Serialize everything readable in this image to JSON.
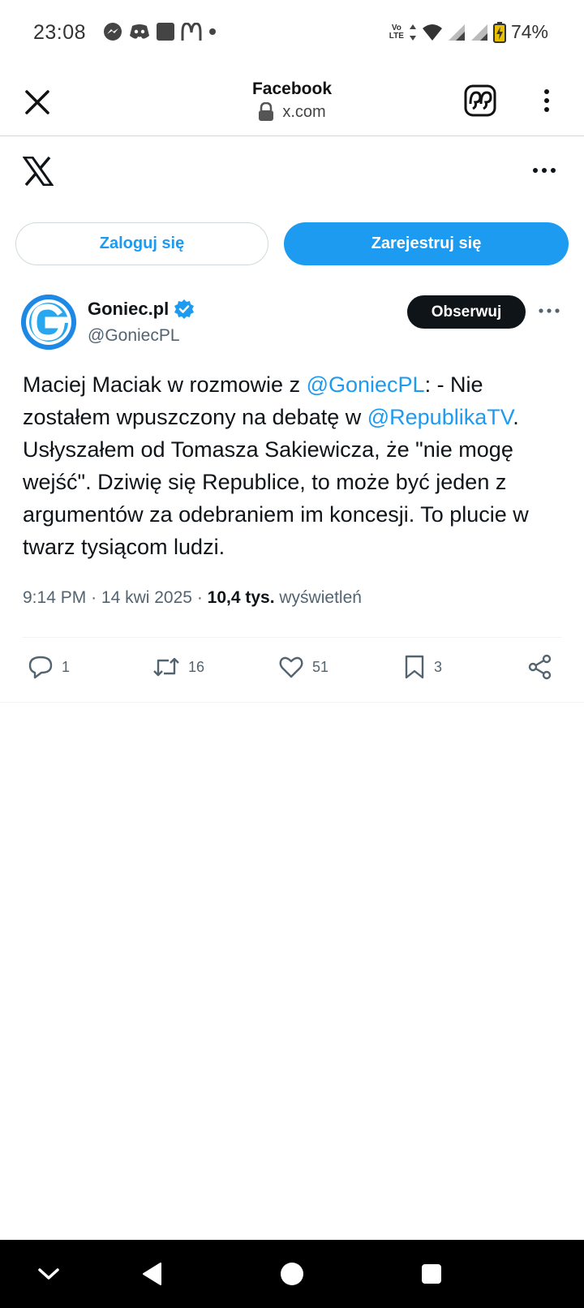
{
  "status_bar": {
    "time": "23:08",
    "battery": "74%",
    "network_top": "Vo",
    "network_bottom": "LTE"
  },
  "browser": {
    "title": "Facebook",
    "url": "x.com"
  },
  "auth": {
    "login_label": "Zaloguj się",
    "register_label": "Zarejestruj się"
  },
  "tweet": {
    "author_name": "Goniec.pl",
    "author_handle": "@GoniecPL",
    "follow_label": "Obserwuj",
    "text_1": "Maciej Maciak w rozmowie z ",
    "mention_1": "@GoniecPL",
    "text_2": ": - Nie zostałem wpuszczony na debatę w ",
    "mention_2": "@RepublikaTV",
    "text_3": ". Usłyszałem od Tomasza Sakiewicza, że \"nie mogę wejść\". Dziwię się Republice, to może być jeden z argumentów za odebraniem im koncesji. To plucie w twarz tysiącom ludzi.",
    "time": "9:14 PM",
    "date": "14 kwi 2025",
    "views_count": "10,4 tys.",
    "views_label": "wyświetleń",
    "replies": "1",
    "reposts": "16",
    "likes": "51",
    "bookmarks": "3"
  },
  "colors": {
    "accent": "#1d9bf0",
    "text": "#0f1419",
    "secondary_text": "#536471",
    "follow_bg": "#0f1419"
  },
  "icons": {
    "close": "close-icon",
    "lock": "lock-icon",
    "reader_quote": "quote-icon",
    "more": "more-vertical-icon",
    "x_logo": "x-logo-icon",
    "verified": "verified-badge-icon",
    "reply": "reply-icon",
    "repost": "repost-icon",
    "like": "heart-icon",
    "bookmark": "bookmark-icon",
    "share": "share-icon"
  }
}
